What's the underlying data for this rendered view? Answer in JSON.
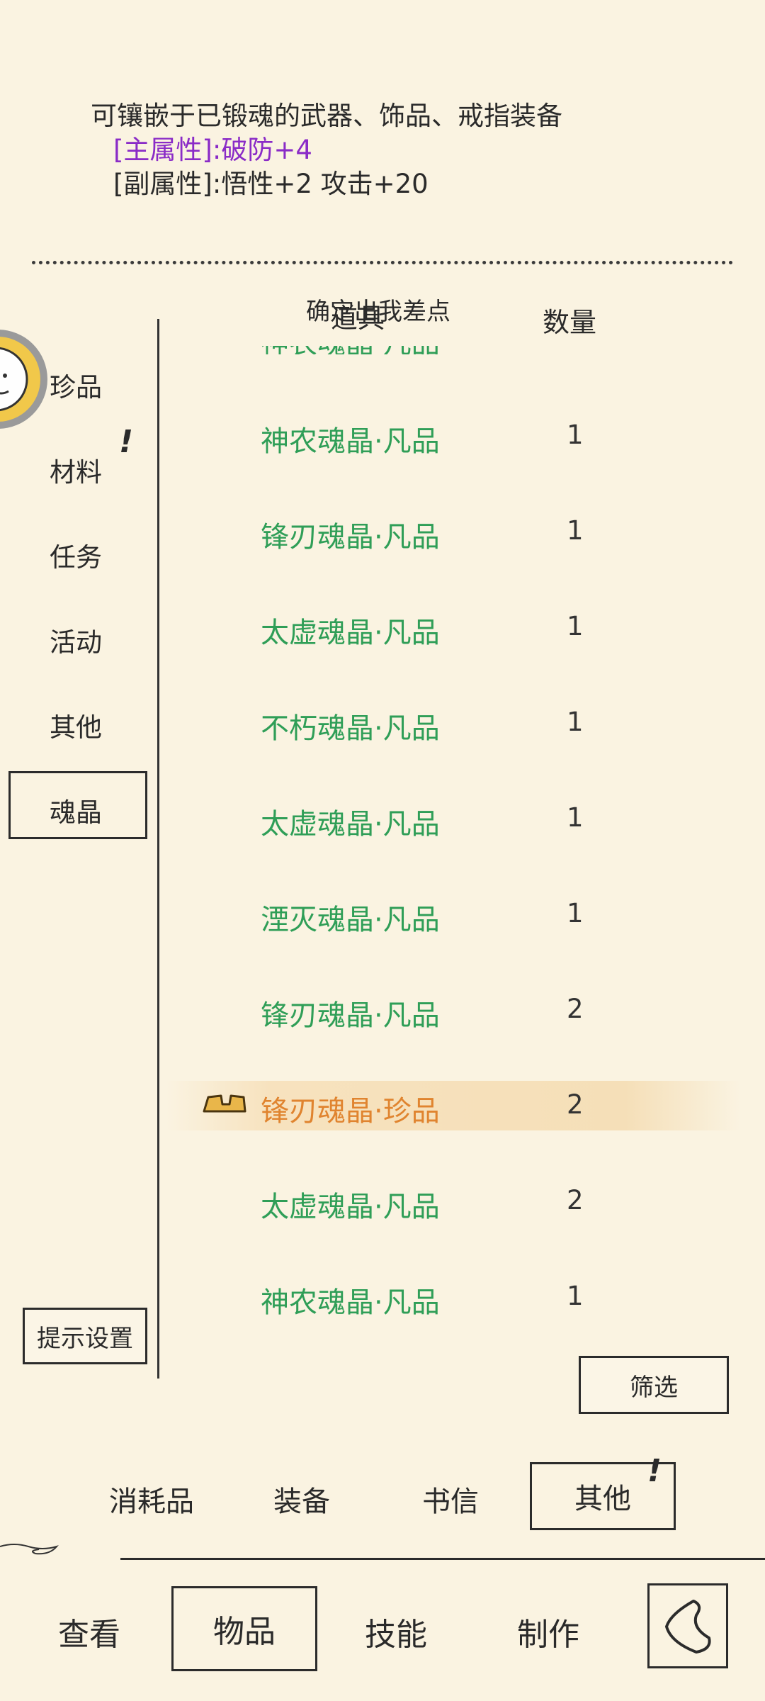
{
  "description": {
    "line1": "可镶嵌于已锻魂的武器、饰品、戒指装备",
    "main_attr": "[主属性]:破防+4",
    "sub_attr": "[副属性]:悟性+2 攻击+20"
  },
  "header": {
    "col_item": "道具",
    "col_qty": "数量",
    "overlay_text": "确定出我差点"
  },
  "categories": [
    "珍品",
    "材料",
    "任务",
    "活动",
    "其他",
    "魂晶"
  ],
  "items": [
    {
      "name": "神农魂晶·凡品",
      "qty": "1"
    },
    {
      "name": "锋刃魂晶·凡品",
      "qty": "1"
    },
    {
      "name": "太虚魂晶·凡品",
      "qty": "1"
    },
    {
      "name": "不朽魂晶·凡品",
      "qty": "1"
    },
    {
      "name": "太虚魂晶·凡品",
      "qty": "1"
    },
    {
      "name": "湮灭魂晶·凡品",
      "qty": "1"
    },
    {
      "name": "锋刃魂晶·凡品",
      "qty": "2"
    },
    {
      "name": "锋刃魂晶·珍品",
      "qty": "2"
    },
    {
      "name": "太虚魂晶·凡品",
      "qty": "2"
    },
    {
      "name": "神农魂晶·凡品",
      "qty": "1"
    }
  ],
  "buttons": {
    "hint_settings": "提示设置",
    "filter": "筛选"
  },
  "type_tabs": [
    "消耗品",
    "装备",
    "书信",
    "其他"
  ],
  "nav": [
    "查看",
    "物品",
    "技能",
    "制作"
  ],
  "colors": {
    "background": "#faf3e1",
    "common_item": "#2f9e57",
    "rare_item": "#e0842f",
    "main_attr": "#8a2bc7",
    "highlight": "#f5dfb8"
  },
  "icons": {
    "selected_item": "equipped-tag-icon",
    "back": "back-arrow-icon",
    "avatar": "cat-avatar-icon"
  }
}
